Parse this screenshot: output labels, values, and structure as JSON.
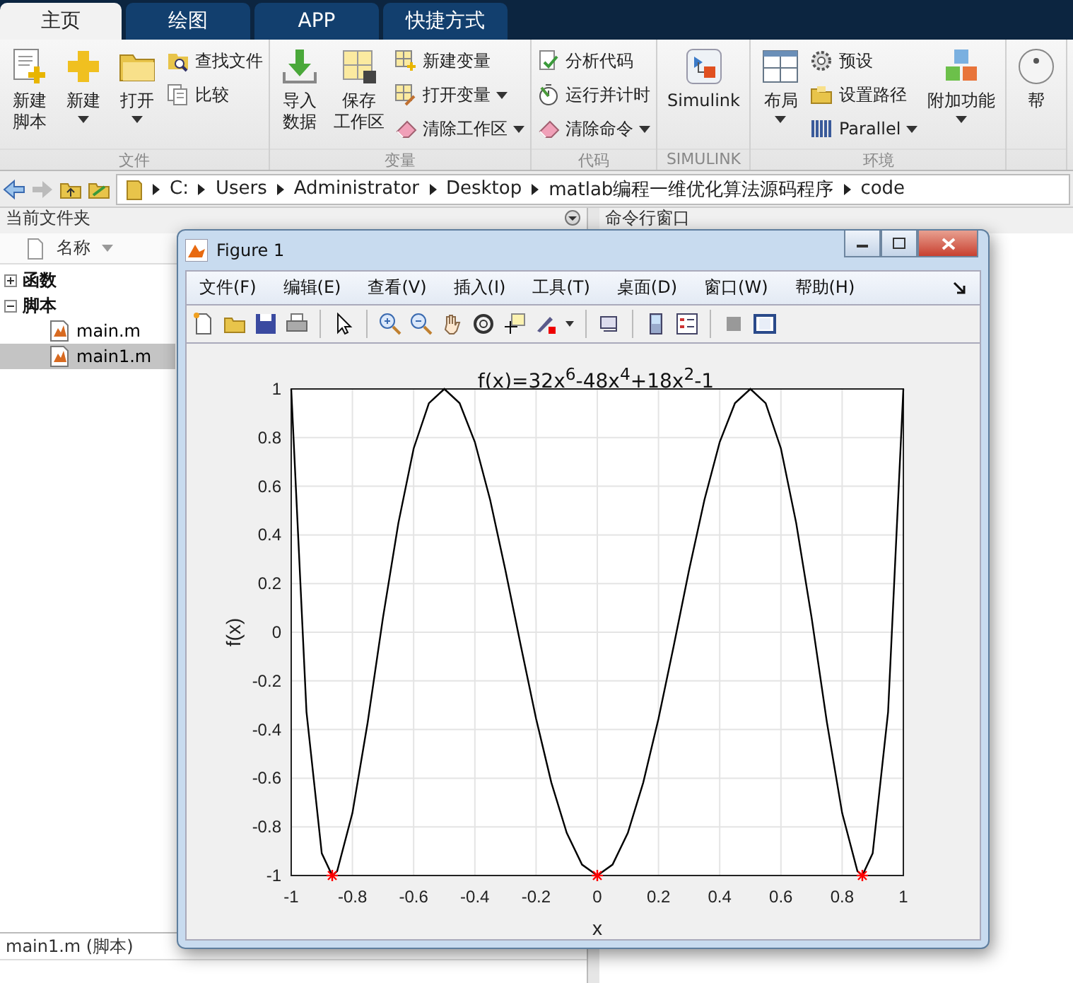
{
  "tabs": [
    {
      "label": "主页",
      "selected": true
    },
    {
      "label": "绘图",
      "selected": false
    },
    {
      "label": "APP",
      "selected": false
    },
    {
      "label": "快捷方式",
      "selected": false
    }
  ],
  "ribbon": {
    "groups": [
      {
        "label": "文件",
        "items": [
          {
            "kind": "large",
            "lines": [
              "新建",
              "脚本"
            ],
            "dropdown": false
          },
          {
            "kind": "large",
            "label": "新建",
            "dropdown": true
          },
          {
            "kind": "large",
            "label": "打开",
            "dropdown": true
          },
          {
            "kind": "small",
            "label": "查找文件",
            "dropdown": false
          },
          {
            "kind": "small",
            "label": "比较",
            "dropdown": false
          }
        ]
      },
      {
        "label": "变量",
        "items": [
          {
            "kind": "large",
            "lines": [
              "导入",
              "数据"
            ],
            "dropdown": false
          },
          {
            "kind": "large",
            "lines": [
              "保存",
              "工作区"
            ],
            "dropdown": false
          },
          {
            "kind": "small",
            "label": "新建变量",
            "dropdown": false
          },
          {
            "kind": "small",
            "label": "打开变量",
            "dropdown": true
          },
          {
            "kind": "small",
            "label": "清除工作区",
            "dropdown": true
          }
        ]
      },
      {
        "label": "代码",
        "items": [
          {
            "kind": "small",
            "label": "分析代码",
            "dropdown": false
          },
          {
            "kind": "small",
            "label": "运行并计时",
            "dropdown": false
          },
          {
            "kind": "small",
            "label": "清除命令",
            "dropdown": true
          }
        ]
      },
      {
        "label": "SIMULINK",
        "items": [
          {
            "kind": "large",
            "label": "Simulink",
            "dropdown": false
          }
        ]
      },
      {
        "label": "环境",
        "items": [
          {
            "kind": "large",
            "label": "布局",
            "dropdown": true
          },
          {
            "kind": "small",
            "label": "预设",
            "dropdown": false
          },
          {
            "kind": "small",
            "label": "设置路径",
            "dropdown": false
          },
          {
            "kind": "small",
            "label": "Parallel",
            "dropdown": true
          },
          {
            "kind": "large",
            "label": "附加功能",
            "dropdown": true
          }
        ]
      },
      {
        "items": [
          {
            "kind": "large",
            "label": "帮",
            "dropdown": false
          }
        ]
      }
    ]
  },
  "address": {
    "path": [
      "C:",
      "Users",
      "Administrator",
      "Desktop",
      "matlab编程一维优化算法源码程序",
      "code"
    ]
  },
  "current_folder": {
    "title": "当前文件夹",
    "column": "名称",
    "tree": [
      {
        "label": "函数",
        "expanded": false
      },
      {
        "label": "脚本",
        "expanded": true,
        "children": [
          {
            "label": "main.m",
            "selected": false
          },
          {
            "label": "main1.m",
            "selected": true
          }
        ]
      }
    ]
  },
  "command_window": {
    "title": "命令行窗口"
  },
  "details": {
    "text": "main1.m  (脚本)"
  },
  "figure": {
    "title": "Figure 1",
    "menus": [
      "文件(F)",
      "编辑(E)",
      "查看(V)",
      "插入(I)",
      "工具(T)",
      "桌面(D)",
      "窗口(W)",
      "帮助(H)"
    ],
    "axes": {
      "chart_data": {
        "type": "line",
        "title": "f(x)=32x$^{6}$-48x$^{4}$+18x$^{2}$-1",
        "xlabel": "x",
        "ylabel": "f(x)",
        "x": [
          -1,
          -0.95,
          -0.9,
          -0.866,
          -0.85,
          -0.8,
          -0.75,
          -0.7,
          -0.65,
          -0.6,
          -0.55,
          -0.5,
          -0.45,
          -0.4,
          -0.35,
          -0.3,
          -0.25,
          -0.2,
          -0.15,
          -0.1,
          -0.05,
          0,
          0.05,
          0.1,
          0.15,
          0.2,
          0.25,
          0.3,
          0.35,
          0.4,
          0.45,
          0.5,
          0.55,
          0.6,
          0.65,
          0.7,
          0.75,
          0.8,
          0.85,
          0.866,
          0.9,
          0.95,
          1
        ],
        "series": [
          {
            "color": "#000000",
            "values": [
              1,
              -0.328,
              -0.909,
              -1,
              -0.982,
              -0.743,
              -0.37,
              0.06,
              0.449,
              0.755,
              0.941,
              1,
              0.942,
              0.782,
              0.544,
              0.255,
              -0.055,
              -0.355,
              -0.618,
              -0.825,
              -0.955,
              -1,
              -0.955,
              -0.825,
              -0.618,
              -0.355,
              -0.055,
              0.255,
              0.544,
              0.782,
              0.942,
              1,
              0.941,
              0.755,
              0.449,
              0.06,
              -0.37,
              -0.743,
              -0.982,
              -1,
              -0.909,
              -0.328,
              1
            ]
          },
          {
            "color": "#ff0000",
            "values": [
              null,
              null,
              null,
              -1,
              null,
              null,
              null,
              null,
              null,
              null,
              null,
              null,
              null,
              null,
              null,
              null,
              null,
              null,
              null,
              null,
              null,
              -1,
              null,
              null,
              null,
              null,
              null,
              null,
              null,
              null,
              null,
              null,
              null,
              null,
              null,
              null,
              null,
              null,
              null,
              -1,
              null,
              null,
              null
            ]
          }
        ],
        "grid": true,
        "xlim": [
          -1,
          1
        ],
        "ylim": [
          -1,
          1
        ],
        "xticks": [
          -1,
          -0.8,
          -0.6,
          -0.4,
          -0.2,
          0,
          0.2,
          0.4,
          0.6,
          0.8,
          1
        ],
        "yticks": [
          -1,
          -0.8,
          -0.6,
          -0.4,
          -0.2,
          0,
          0.2,
          0.4,
          0.6,
          0.8,
          1
        ]
      }
    }
  }
}
